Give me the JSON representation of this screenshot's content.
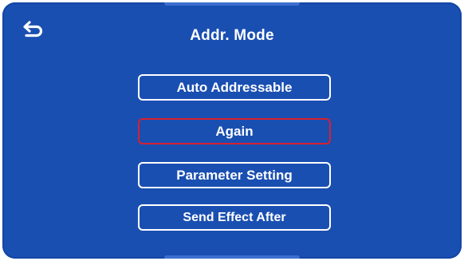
{
  "header": {
    "back_icon": "return-arrow-icon",
    "title": "Addr. Mode"
  },
  "menu": {
    "items": [
      {
        "label": "Auto Addressable",
        "selected": false
      },
      {
        "label": "Again",
        "selected": true
      },
      {
        "label": "Parameter Setting",
        "selected": false
      },
      {
        "label": "Send Effect After",
        "selected": false
      }
    ]
  },
  "colors": {
    "background": "#1a4fb2",
    "text": "#ffffff",
    "selected_border": "#d8202e"
  }
}
